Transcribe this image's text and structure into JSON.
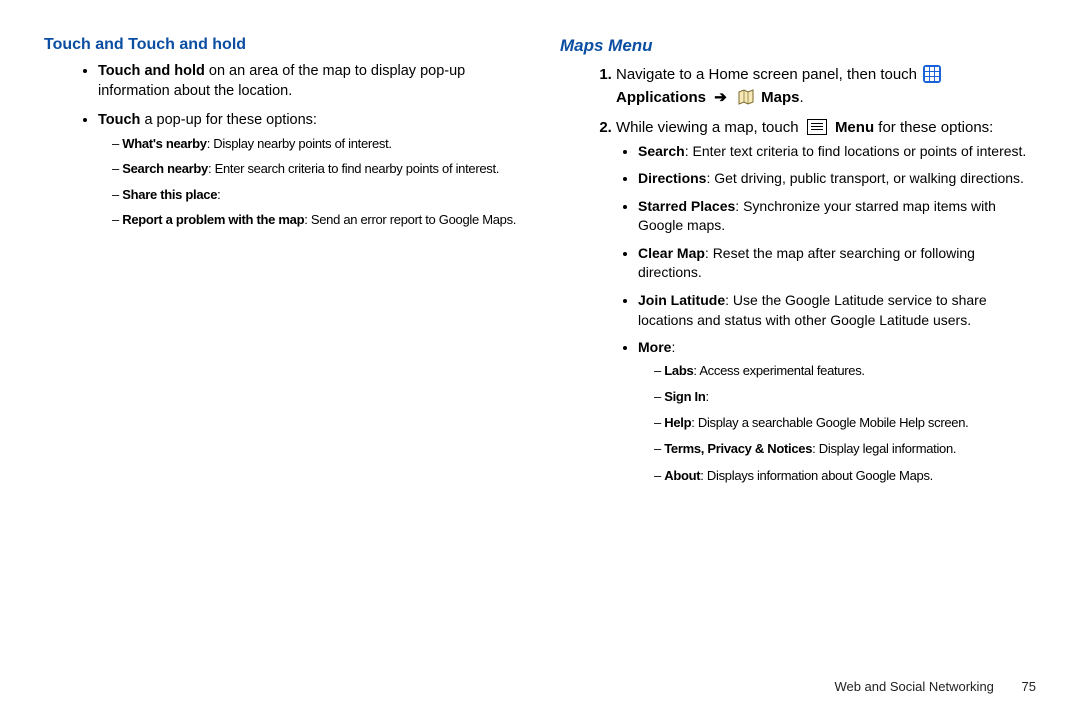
{
  "left": {
    "heading": "Touch and Touch and hold",
    "b1": {
      "bold": "Touch and hold",
      "rest": " on an area of the map to display pop-up information about the location."
    },
    "b2": {
      "bold": "Touch",
      "rest": " a pop-up for these options:"
    },
    "sub": {
      "s1": {
        "bold": "What's nearby",
        "rest": ": Display nearby points of interest."
      },
      "s2": {
        "bold": "Search nearby",
        "rest": ": Enter search criteria to find nearby points of interest."
      },
      "s3": {
        "bold": "Share this place",
        "rest": ":"
      },
      "s4": {
        "bold": "Report a problem with the map",
        "rest": ": Send an error report to Google Maps."
      }
    }
  },
  "right": {
    "heading": "Maps Menu",
    "step1": {
      "pre": "Navigate to a Home screen panel, then touch ",
      "apps": "Applications",
      "arrow": "➔",
      "maps": "Maps",
      "dot": "."
    },
    "step2": {
      "pre": "While viewing a map, touch ",
      "menu": "Menu",
      "post": " for these options:"
    },
    "opts": {
      "o1": {
        "bold": "Search",
        "rest": ": Enter text criteria to find locations or points of interest."
      },
      "o2": {
        "bold": "Directions",
        "rest": ": Get driving, public transport, or walking directions."
      },
      "o3": {
        "bold": "Starred Places",
        "rest": ": Synchronize your starred map items with Google maps."
      },
      "o4": {
        "bold": "Clear Map",
        "rest": ": Reset the map after searching or following directions."
      },
      "o5": {
        "bold": "Join Latitude",
        "rest": ": Use the Google Latitude service to share locations and status with other Google Latitude users."
      },
      "o6": {
        "bold": "More",
        "rest": ":"
      }
    },
    "more": {
      "m1": {
        "bold": "Labs",
        "rest": ": Access experimental features."
      },
      "m2": {
        "bold": "Sign In",
        "rest": ":"
      },
      "m3": {
        "bold": "Help",
        "rest": ": Display a searchable Google Mobile Help screen."
      },
      "m4": {
        "bold": "Terms, Privacy & Notices",
        "rest": ": Display legal information."
      },
      "m5": {
        "bold": "About",
        "rest": ": Displays information about Google Maps."
      }
    }
  },
  "footer": {
    "section": "Web and Social Networking",
    "page": "75"
  }
}
